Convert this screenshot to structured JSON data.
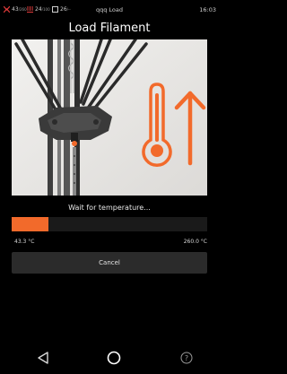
{
  "status_bar": {
    "hotend_temp": "43",
    "hotend_unit": "/260",
    "bed_temp": "24",
    "bed_unit": "/100",
    "chamber_temp": "26",
    "chamber_unit": "/--",
    "device_name": "qqq Load",
    "time": "16:03"
  },
  "page": {
    "title": "Load Filament"
  },
  "progress": {
    "status_text": "Wait for temperature...",
    "fraction": 0.19,
    "current_temp": "43.3 °C",
    "target_temp": "260.0 °C"
  },
  "buttons": {
    "cancel_label": "Cancel"
  },
  "icons": {
    "thermometer": "thermometer-icon",
    "arrow_up": "arrow-up-icon",
    "nav_back": "back-triangle-icon",
    "nav_home": "home-circle-icon",
    "nav_help": "help-icon"
  },
  "colors": {
    "accent": "#f26a2b",
    "button_bg": "#2b2b2b",
    "background": "#000000"
  }
}
